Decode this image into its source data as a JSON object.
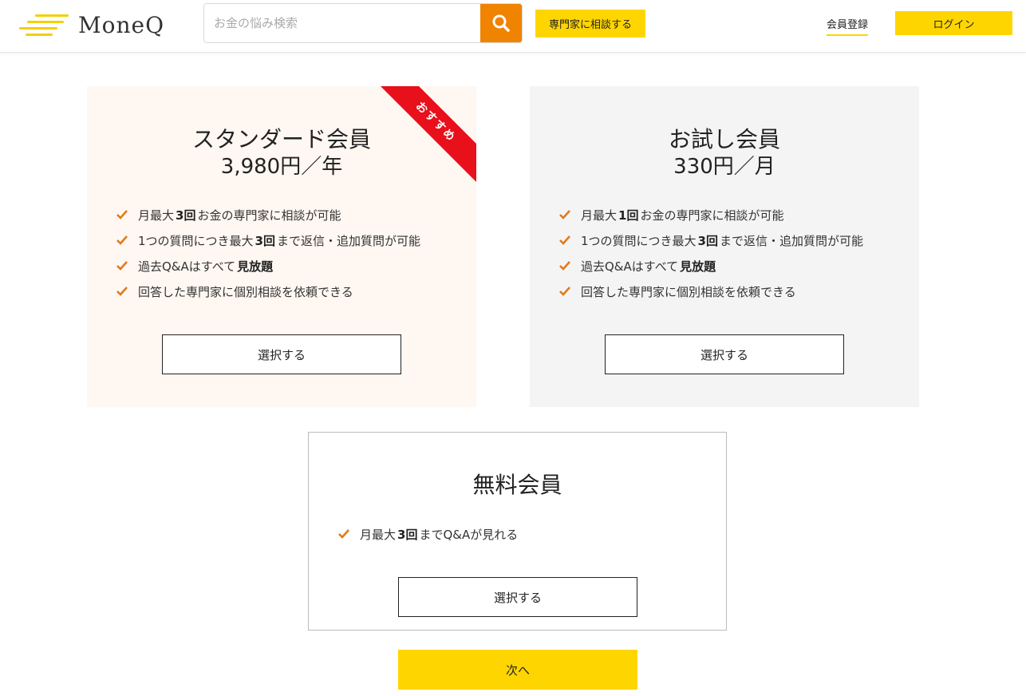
{
  "header": {
    "logo_text": "MoneQ",
    "search_placeholder": "お金の悩み検索",
    "consult_label": "専門家に相談する",
    "register_label": "会員登録",
    "login_label": "ログイン"
  },
  "plans": {
    "standard": {
      "title": "スタンダード会員",
      "price": "3,980円／年",
      "badge": "おすすめ",
      "features": [
        {
          "pre": "月最大",
          "bold": "3回",
          "post": "お金の専門家に相談が可能"
        },
        {
          "pre": "1つの質問につき最大",
          "bold": "3回",
          "post": "まで返信・追加質問が可能"
        },
        {
          "pre": "過去Q&Aはすべて",
          "bold": "見放題",
          "post": ""
        },
        {
          "pre": "回答した専門家に個別相談を依頼できる",
          "bold": "",
          "post": ""
        }
      ],
      "select_label": "選択する"
    },
    "trial": {
      "title": "お試し会員",
      "price": "330円／月",
      "features": [
        {
          "pre": "月最大",
          "bold": "1回",
          "post": "お金の専門家に相談が可能"
        },
        {
          "pre": "1つの質問につき最大",
          "bold": "3回",
          "post": "まで返信・追加質問が可能"
        },
        {
          "pre": "過去Q&Aはすべて",
          "bold": "見放題",
          "post": ""
        },
        {
          "pre": "回答した専門家に個別相談を依頼できる",
          "bold": "",
          "post": ""
        }
      ],
      "select_label": "選択する"
    },
    "free": {
      "title": "無料会員",
      "features": [
        {
          "pre": "月最大",
          "bold": "3回",
          "post": "までQ&Aが見れる"
        }
      ],
      "select_label": "選択する"
    }
  },
  "next_label": "次へ",
  "colors": {
    "accent_yellow": "#ffd500",
    "accent_orange": "#f08300",
    "check_orange": "#e07b1a",
    "ribbon_red": "#e8101b"
  },
  "icons": {
    "search": "search-icon",
    "check": "check-icon",
    "logo": "logo-lines-icon"
  }
}
